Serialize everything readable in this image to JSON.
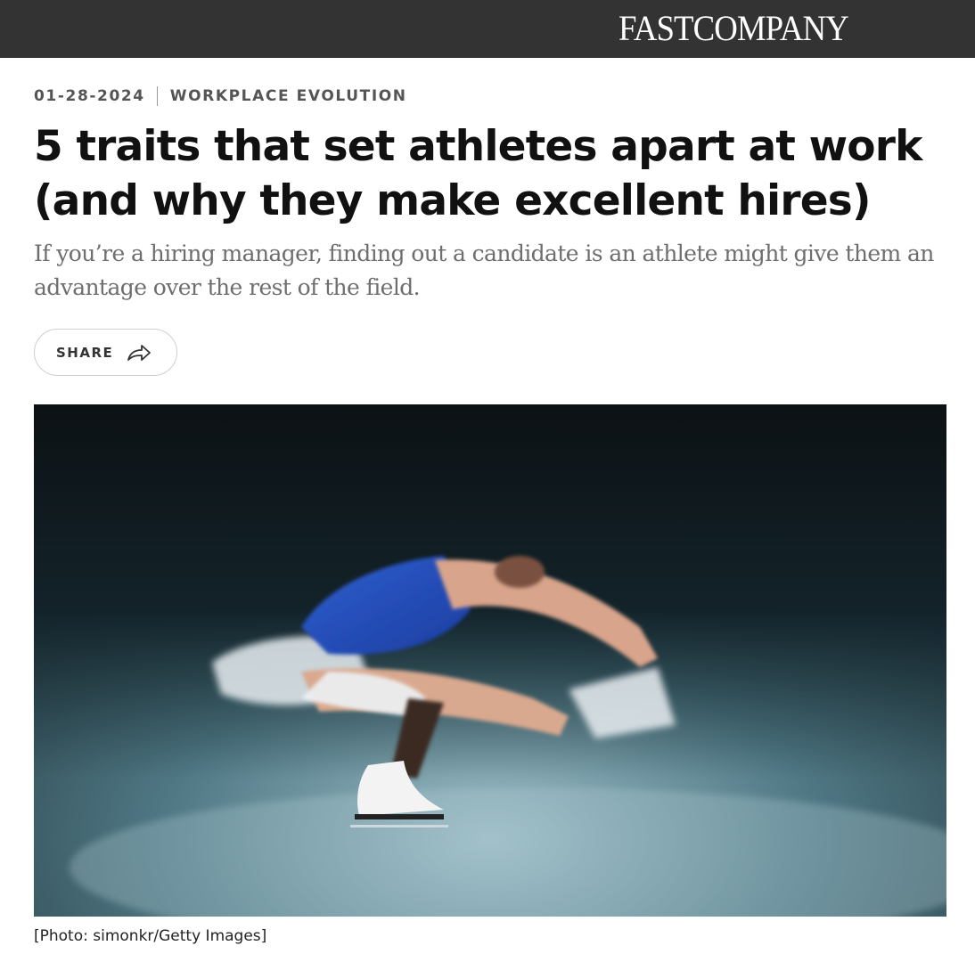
{
  "header": {
    "logo_text": "FASTCOMPANY",
    "bar_color": "#333333"
  },
  "article": {
    "date": "01-28-2024",
    "category": "WORKPLACE EVOLUTION",
    "title": "5 traits that set athletes apart at work (and why they make excellent hires)",
    "dek": "If you’re a hiring manager, finding out a candidate is an athlete might give them an advantage over the rest of the field.",
    "share_label": "SHARE",
    "share_icon": "share-arrow-icon",
    "image": {
      "subject": "figure-skater-photo",
      "caption": "[Photo: simonkr/Getty Images]"
    }
  }
}
